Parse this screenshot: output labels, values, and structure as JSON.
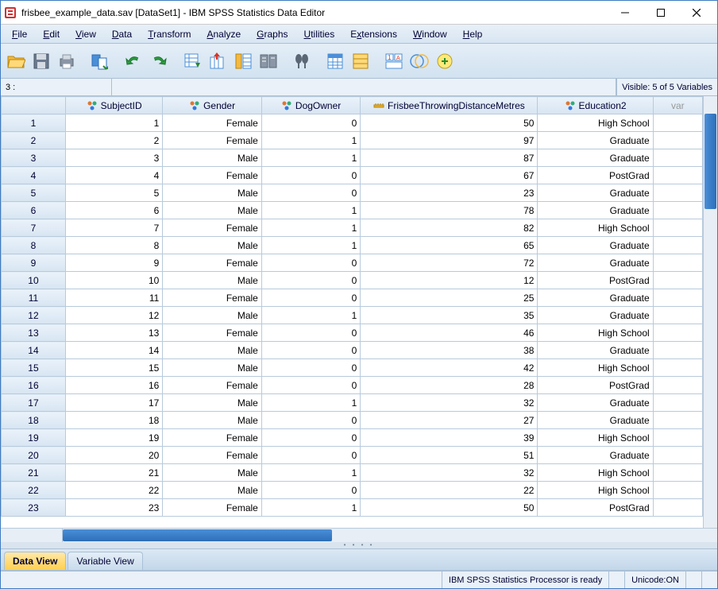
{
  "titlebar": {
    "text": "frisbee_example_data.sav [DataSet1] - IBM SPSS Statistics Data Editor"
  },
  "menu": {
    "file": "File",
    "edit": "Edit",
    "view": "View",
    "data": "Data",
    "transform": "Transform",
    "analyze": "Analyze",
    "graphs": "Graphs",
    "utilities": "Utilities",
    "extensions": "Extensions",
    "window": "Window",
    "help": "Help"
  },
  "infobar": {
    "cell_label": "3 :",
    "visible": "Visible: 5 of 5 Variables"
  },
  "columns": {
    "subjectid": "SubjectID",
    "gender": "Gender",
    "dogowner": "DogOwner",
    "frisbee": "FrisbeeThrowingDistanceMetres",
    "education": "Education2",
    "var": "var"
  },
  "rows": [
    {
      "n": "1",
      "subj": "1",
      "gender": "Female",
      "dog": "0",
      "dist": "50",
      "edu": "High School"
    },
    {
      "n": "2",
      "subj": "2",
      "gender": "Female",
      "dog": "1",
      "dist": "97",
      "edu": "Graduate"
    },
    {
      "n": "3",
      "subj": "3",
      "gender": "Male",
      "dog": "1",
      "dist": "87",
      "edu": "Graduate"
    },
    {
      "n": "4",
      "subj": "4",
      "gender": "Female",
      "dog": "0",
      "dist": "67",
      "edu": "PostGrad"
    },
    {
      "n": "5",
      "subj": "5",
      "gender": "Male",
      "dog": "0",
      "dist": "23",
      "edu": "Graduate"
    },
    {
      "n": "6",
      "subj": "6",
      "gender": "Male",
      "dog": "1",
      "dist": "78",
      "edu": "Graduate"
    },
    {
      "n": "7",
      "subj": "7",
      "gender": "Female",
      "dog": "1",
      "dist": "82",
      "edu": "High School"
    },
    {
      "n": "8",
      "subj": "8",
      "gender": "Male",
      "dog": "1",
      "dist": "65",
      "edu": "Graduate"
    },
    {
      "n": "9",
      "subj": "9",
      "gender": "Female",
      "dog": "0",
      "dist": "72",
      "edu": "Graduate"
    },
    {
      "n": "10",
      "subj": "10",
      "gender": "Male",
      "dog": "0",
      "dist": "12",
      "edu": "PostGrad"
    },
    {
      "n": "11",
      "subj": "11",
      "gender": "Female",
      "dog": "0",
      "dist": "25",
      "edu": "Graduate"
    },
    {
      "n": "12",
      "subj": "12",
      "gender": "Male",
      "dog": "1",
      "dist": "35",
      "edu": "Graduate"
    },
    {
      "n": "13",
      "subj": "13",
      "gender": "Female",
      "dog": "0",
      "dist": "46",
      "edu": "High School"
    },
    {
      "n": "14",
      "subj": "14",
      "gender": "Male",
      "dog": "0",
      "dist": "38",
      "edu": "Graduate"
    },
    {
      "n": "15",
      "subj": "15",
      "gender": "Male",
      "dog": "0",
      "dist": "42",
      "edu": "High School"
    },
    {
      "n": "16",
      "subj": "16",
      "gender": "Female",
      "dog": "0",
      "dist": "28",
      "edu": "PostGrad"
    },
    {
      "n": "17",
      "subj": "17",
      "gender": "Male",
      "dog": "1",
      "dist": "32",
      "edu": "Graduate"
    },
    {
      "n": "18",
      "subj": "18",
      "gender": "Male",
      "dog": "0",
      "dist": "27",
      "edu": "Graduate"
    },
    {
      "n": "19",
      "subj": "19",
      "gender": "Female",
      "dog": "0",
      "dist": "39",
      "edu": "High School"
    },
    {
      "n": "20",
      "subj": "20",
      "gender": "Female",
      "dog": "0",
      "dist": "51",
      "edu": "Graduate"
    },
    {
      "n": "21",
      "subj": "21",
      "gender": "Male",
      "dog": "1",
      "dist": "32",
      "edu": "High School"
    },
    {
      "n": "22",
      "subj": "22",
      "gender": "Male",
      "dog": "0",
      "dist": "22",
      "edu": "High School"
    },
    {
      "n": "23",
      "subj": "23",
      "gender": "Female",
      "dog": "1",
      "dist": "50",
      "edu": "PostGrad"
    }
  ],
  "tabs": {
    "data_view": "Data View",
    "variable_view": "Variable View"
  },
  "status": {
    "processor": "IBM SPSS Statistics Processor is ready",
    "unicode": "Unicode:ON"
  }
}
